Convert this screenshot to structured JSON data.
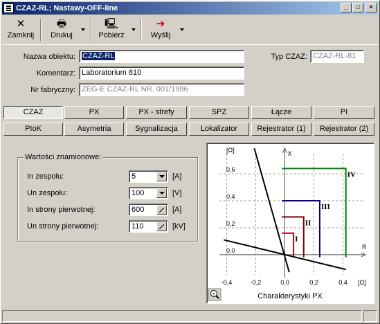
{
  "window": {
    "title": "CZAZ-RL; Nastawy-OFF-line"
  },
  "toolbar": {
    "close_label": "Zamknij",
    "print_label": "Drukuj",
    "fetch_label": "Pobierz",
    "send_label": "Wyślij"
  },
  "form": {
    "object_name_label": "Nazwa obiektu:",
    "object_name_value": "CZAZ-RL",
    "comment_label": "Komentarz:",
    "comment_value": "Laboratorium 810",
    "serial_label": "Nr fabryczny:",
    "serial_value": "ZEG-E CZAZ-RL NR. 001/1996",
    "type_label": "Typ CZAZ:",
    "type_value": "CZAZ-RL-81"
  },
  "tabs_row1": [
    "CZAZ",
    "PX",
    "PX - strefy",
    "SPZ",
    "Łącze",
    "PI"
  ],
  "tabs_row2": [
    "PIoK",
    "Asymetria",
    "Sygnalizacja",
    "Lokalizator",
    "Rejestrator (1)",
    "Rejestrator (2)"
  ],
  "ratings": {
    "group_title": "Wartości znamionowe:",
    "rows": [
      {
        "label": "In zespołu:",
        "value": "5",
        "unit": "[A]"
      },
      {
        "label": "Un zespołu:",
        "value": "100",
        "unit": "[V]"
      },
      {
        "label": "In strony pierwotnej:",
        "value": "600",
        "unit": "[A]"
      },
      {
        "label": "Un strony pierwotnej:",
        "value": "110",
        "unit": "[kV]"
      }
    ]
  },
  "chart_data": {
    "type": "line",
    "title": "Charakterystyki PX",
    "xlabel": "R",
    "ylabel": "X",
    "x_unit": "[Ω]",
    "y_unit": "[Ω]",
    "xlim": [
      -0.45,
      0.55
    ],
    "ylim": [
      -0.15,
      0.75
    ],
    "x_ticks": [
      "-0,4",
      "-0,2",
      "0,0",
      "0,2",
      "0,4"
    ],
    "y_ticks": [
      "0,0",
      "0,2",
      "0,4",
      "0,6"
    ],
    "x_tick_values": [
      -0.4,
      -0.2,
      0.0,
      0.2,
      0.4
    ],
    "y_tick_values": [
      0.0,
      0.2,
      0.4,
      0.6
    ],
    "grid": true,
    "zones": [
      {
        "name": "I",
        "x0": -0.02,
        "r": 0.06,
        "x": 0.16,
        "color": "#c00000"
      },
      {
        "name": "II",
        "x0": -0.02,
        "r": 0.13,
        "x": 0.28,
        "color": "#800000"
      },
      {
        "name": "III",
        "x0": -0.02,
        "r": 0.24,
        "x": 0.4,
        "color": "#00008b"
      },
      {
        "name": "IV",
        "x0": -0.02,
        "r": 0.42,
        "x": 0.64,
        "color": "#008000"
      }
    ],
    "lines": [
      {
        "from": [
          -0.21,
          0.79
        ],
        "to": [
          0.03,
          -0.13
        ]
      },
      {
        "from": [
          -0.42,
          0.11
        ],
        "to": [
          0.42,
          -0.11
        ]
      }
    ]
  },
  "chart_extra": {
    "zoom_icon": "magnifier-plus-icon"
  }
}
